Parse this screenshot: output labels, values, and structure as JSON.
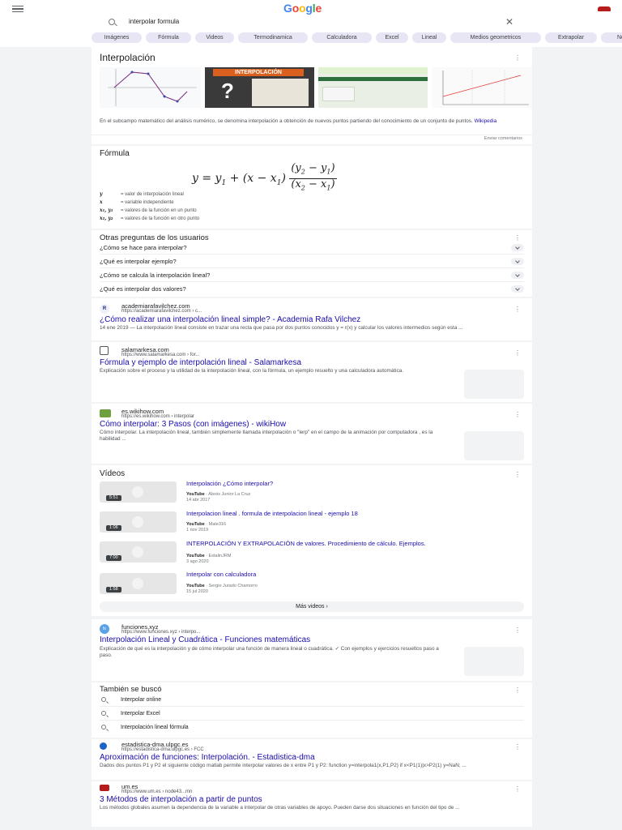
{
  "header": {
    "logo": [
      "G",
      "o",
      "o",
      "g",
      "l",
      "e"
    ],
    "query": "interpolar formula"
  },
  "chips": [
    "Imágenes",
    "Fórmula",
    "Videos",
    "Termodinamica",
    "Calculadora",
    "Excel",
    "Lineal",
    "Medios geometricos",
    "Extrapolar",
    "Not"
  ],
  "kp": {
    "title": "Interpolación",
    "thumb2_title": "INTERPOLACIÓN",
    "description": "En el subcampo matemático del análisis numérico, se denomina interpolación a obtención de nuevos puntos partiendo del conocimiento de un conjunto de puntos.",
    "source": "Wikipedia",
    "feedback": "Enviar comentarios"
  },
  "formula": {
    "title": "Fórmula",
    "legend": [
      {
        "sym": "y",
        "desc": "= valor de interpolación lineal"
      },
      {
        "sym": "x",
        "desc": "= variable independiente"
      },
      {
        "sym": "x₁, y₁",
        "desc": "= valores de la función en un punto"
      },
      {
        "sym": "x₂, y₂",
        "desc": "= valores de la función en otro punto"
      }
    ]
  },
  "paa": {
    "title": "Otras preguntas de los usuarios",
    "questions": [
      "¿Cómo se hace para interpolar?",
      "¿Qué es interpolar ejemplo?",
      "¿Cómo se calcula la interpolación lineal?",
      "¿Qué es interpolar dos valores?"
    ]
  },
  "results": [
    {
      "site": "academiarafavilchez.com",
      "url": "https://academiarafavilchez.com › c...",
      "title": "¿Cómo realizar una interpolación lineal simple? - Academia Rafa Vilchez",
      "snippet": "14 ene 2019 — La interpolación lineal consiste en trazar una recta que pasa por dos puntos conocidos y = r(x) y calcular los valores intermedios según esta ..."
    },
    {
      "site": "salamarkesa.com",
      "url": "https://www.salamarkesa.com › for...",
      "title": "Fórmula y ejemplo de interpolación lineal - Salamarkesa",
      "snippet": "Explicación sobre el proceso y la utilidad de la interpolación lineal, con la fórmula, un ejemplo resuelto y una calculadora automática."
    },
    {
      "site": "es.wikihow.com",
      "url": "https://es.wikihow.com › interpolar",
      "title": "Cómo interpolar: 3 Pasos (con imágenes) - wikiHow",
      "snippet": "Cómo interpolar. La interpolación lineal, también simplemente llamada interpolación o \"lerp\" en el campo de la animación por computadora , es la habilidad ..."
    }
  ],
  "videos": {
    "title": "Vídeos",
    "items": [
      {
        "title": "Interpolación ¿Cómo interpolar?",
        "source": "YouTube",
        "author": "· Alexis Junior La Cruz",
        "date": "14 abr 2017",
        "duration": "5:51"
      },
      {
        "title": "Interpolacion lineal . formula de interpolacion lineal - ejemplo 18",
        "source": "YouTube",
        "author": "· Mate316",
        "date": "1 nov 2019",
        "duration": "1:06"
      },
      {
        "title": "INTERPOLACIÓN Y EXTRAPOLACIÓN de valores. Procedimiento de cálculo. Ejemplos.",
        "source": "YouTube",
        "author": "· EstalinJRM",
        "date": "3 ago 2020",
        "duration": "7:00"
      },
      {
        "title": "Interpolar con calculadora",
        "source": "YouTube",
        "author": "· Sergio Jurado Chamorro",
        "date": "15 jul 2020",
        "duration": "1:58"
      }
    ],
    "more": "Más videos"
  },
  "result4": {
    "site": "funciones.xyz",
    "url": "https://www.funciones.xyz › interpo...",
    "title": "Interpolación Lineal y Cuadrática - Funciones matemáticas",
    "snippet": "Explicación de qué es la interpolación y de cómo interpolar una función de manera lineal o cuadrática. ✓ Con ejemplos y ejercicios resueltos paso a paso."
  },
  "related": {
    "title": "También se buscó",
    "items": [
      "Interpolar online",
      "Interpolar Excel",
      "Interpolación lineal fórmula"
    ]
  },
  "result5": {
    "site": "estadistica-dma.ulpgc.es",
    "url": "https://estadistica-dma.ulpgc.es › FCC",
    "title": "Aproximación de funciones: Interpolación. - Estadistica-dma",
    "snippet": "Dados dos puntos P1 y P2 el siguiente código matlab permite interpolar valores de x entre P1 y P2: function y=interpola1(x,P1,P2) if x<P1(1)|x>P2(1) y=NaN; ..."
  },
  "result6": {
    "site": "um.es",
    "url": "https://www.um.es › node43...mn",
    "title": "3 Métodos de interpolación a partir de puntos",
    "snippet": "Los métodos globales asumen la dependencia de la variable a interpolar de otras variables de apoyo. Pueden darse dos situaciones en función del tipo de ..."
  }
}
